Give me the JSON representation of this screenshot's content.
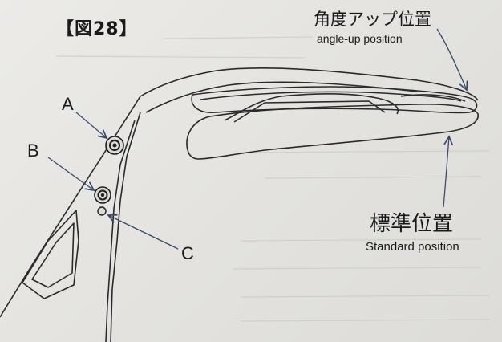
{
  "figure": {
    "title": "【図28】"
  },
  "positions": {
    "angle_up": {
      "label_jp": "角度アップ位置",
      "label_en": "angle-up position"
    },
    "standard": {
      "label_jp": "標準位置",
      "label_en": "Standard position"
    }
  },
  "points": [
    {
      "label": "A"
    },
    {
      "label": "B"
    },
    {
      "label": "C"
    }
  ],
  "colors": {
    "line": "#2a2a2a",
    "arrow": "#3a4a6a",
    "paper": "#e6e5e2"
  }
}
